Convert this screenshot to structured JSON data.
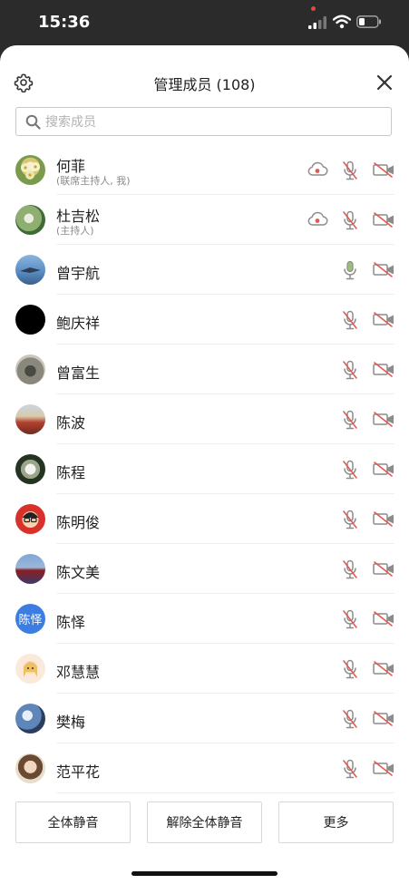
{
  "status_bar": {
    "time": "15:36"
  },
  "header": {
    "title": "管理成员 (108)"
  },
  "search": {
    "placeholder": "搜索成员"
  },
  "members": [
    {
      "name": "何菲",
      "role": "(联席主持人, 我)",
      "recording": true,
      "mic": "muted",
      "camera": "off",
      "avatar": "photo-flowers"
    },
    {
      "name": "杜吉松",
      "role": "(主持人)",
      "recording": true,
      "mic": "muted",
      "camera": "off",
      "avatar": "photo-leaves"
    },
    {
      "name": "曾宇航",
      "role": "",
      "recording": false,
      "mic": "on",
      "camera": "off",
      "avatar": "photo-sky"
    },
    {
      "name": "鲍庆祥",
      "role": "",
      "recording": false,
      "mic": "muted",
      "camera": "off",
      "avatar": "photo-black"
    },
    {
      "name": "曾富生",
      "role": "",
      "recording": false,
      "mic": "muted",
      "camera": "off",
      "avatar": "photo-grey"
    },
    {
      "name": "陈波",
      "role": "",
      "recording": false,
      "mic": "muted",
      "camera": "off",
      "avatar": "photo-building"
    },
    {
      "name": "陈程",
      "role": "",
      "recording": false,
      "mic": "muted",
      "camera": "off",
      "avatar": "photo-white-flower"
    },
    {
      "name": "陈明俊",
      "role": "",
      "recording": false,
      "mic": "muted",
      "camera": "off",
      "avatar": "cartoon-red"
    },
    {
      "name": "陈文美",
      "role": "",
      "recording": false,
      "mic": "muted",
      "camera": "off",
      "avatar": "photo-horses"
    },
    {
      "name": "陈怿",
      "role": "",
      "recording": false,
      "mic": "muted",
      "camera": "off",
      "avatar": "text",
      "avatar_text": "陈怿"
    },
    {
      "name": "邓慧慧",
      "role": "",
      "recording": false,
      "mic": "muted",
      "camera": "off",
      "avatar": "cartoon-girl"
    },
    {
      "name": "樊梅",
      "role": "",
      "recording": false,
      "mic": "muted",
      "camera": "off",
      "avatar": "photo-blossom"
    },
    {
      "name": "范平花",
      "role": "",
      "recording": false,
      "mic": "muted",
      "camera": "off",
      "avatar": "photo-portrait"
    }
  ],
  "actions": {
    "mute_all": "全体静音",
    "unmute_all": "解除全体静音",
    "more": "更多"
  },
  "colors": {
    "muted_red": "#e05a52",
    "icon_grey": "#8c8c8c",
    "mic_on_green": "#9bbf7a",
    "text_avatar_blue": "#3b7de0"
  }
}
